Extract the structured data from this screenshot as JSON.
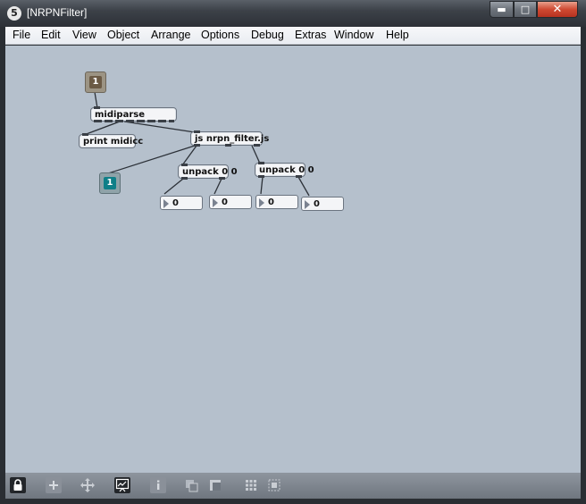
{
  "window": {
    "badge": "5",
    "title": "[NRPNFilter]",
    "buttons": {
      "minimize": "▬",
      "maximize": "□",
      "close": "✕"
    }
  },
  "menu": {
    "items": [
      "File",
      "Edit",
      "View",
      "Object",
      "Arrange",
      "Options",
      "Debug",
      "Extras",
      "Window",
      "Help"
    ]
  },
  "patch": {
    "inlet": "1",
    "outlet": "1",
    "objects": {
      "midiparse": "midiparse",
      "print": "print midicc",
      "js": "js nrpn_filter.js",
      "unpack_left": "unpack 0 0",
      "unpack_right": "unpack 0 0"
    },
    "numbers": [
      "0",
      "0",
      "0",
      "0"
    ]
  },
  "toolbar": {
    "icons": [
      "lock-icon",
      "add-icon",
      "move-icon",
      "presentation-icon",
      "inspector-icon",
      "subpatch-icon",
      "window-icon",
      "grid-icon",
      "snap-icon"
    ]
  },
  "colors": {
    "canvas": "#b5c0cc",
    "inlet_accent": "#6b5a45",
    "outlet_accent": "#0f7f88"
  }
}
